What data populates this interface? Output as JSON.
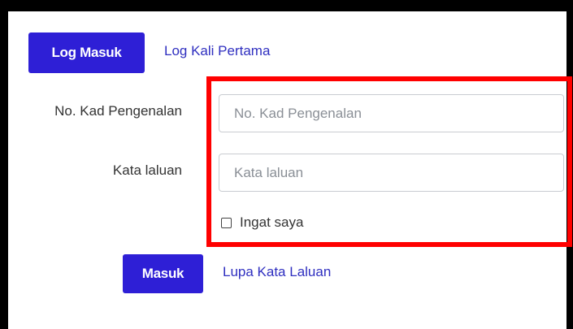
{
  "tabs": {
    "login_label": "Log Masuk",
    "first_login_label": "Log Kali Pertama"
  },
  "form": {
    "id_label": "No. Kad Pengenalan",
    "id_placeholder": "No. Kad Pengenalan",
    "id_value": "",
    "password_label": "Kata laluan",
    "password_placeholder": "Kata laluan",
    "password_value": "",
    "remember_label": "Ingat saya",
    "remember_checked": false
  },
  "actions": {
    "submit_label": "Masuk",
    "forgot_label": "Lupa Kata Laluan"
  },
  "colors": {
    "primary": "#2e1fd6",
    "link": "#2f2fc0",
    "highlight": "#ff0000",
    "frame": "#000000"
  }
}
